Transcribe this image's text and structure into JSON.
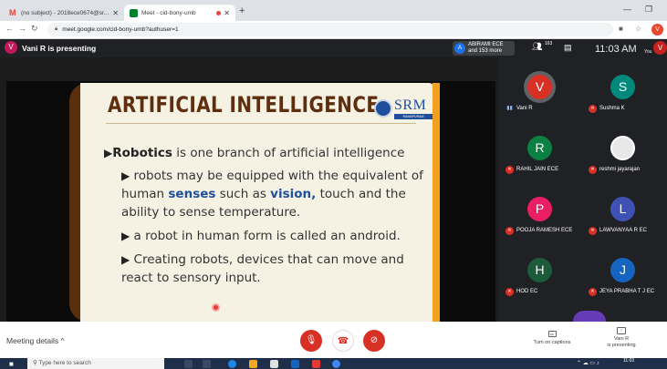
{
  "browser": {
    "tabs": [
      {
        "title": "(no subject) - 2018ece0674@sr...",
        "active": false
      },
      {
        "title": "Meet - cid-bony-umb",
        "active": true
      }
    ],
    "url": "meet.google.com/cid-bony-umb?authuser=1",
    "profile_initial": "V"
  },
  "meet": {
    "presenter_initial": "V",
    "presenter_text": "Vani R is presenting",
    "attendee_initial": "A",
    "attendee_name": "ABIRAMI ECE",
    "attendee_more": "and 153 more",
    "people_count": "163",
    "time": "11:03 AM",
    "you_label": "You",
    "self_initial": "V"
  },
  "slide": {
    "title": "ARTIFICIAL INTELLIGENCE",
    "logo_text": "SRM",
    "logo_sub": "RAMAPURAM",
    "bullet_main_bold": "Robotics",
    "bullet_main_rest": " is one branch of artificial intelligence",
    "sub1_a": "robots may be equipped with the equivalent of human ",
    "sub1_kw1": "senses",
    "sub1_b": " such as ",
    "sub1_kw2": "vision,",
    "sub1_c": " touch and the ability to sense temperature.",
    "sub2": "a robot in human form is called an android.",
    "sub3": "Creating robots, devices that can move and react to sensory input."
  },
  "participants": [
    {
      "name": "Vani R",
      "initial": "V",
      "color": "#d93025",
      "mic_on": true
    },
    {
      "name": "Sushma K",
      "initial": "S",
      "color": "#00897b",
      "mic_on": false
    },
    {
      "name": "RAHIL JAIN ECE",
      "initial": "R",
      "color": "#0b8043",
      "mic_on": false
    },
    {
      "name": "reshmi jayarajan",
      "initial": "",
      "color": "#e8e8e8",
      "mic_on": false
    },
    {
      "name": "POOJA RAMESH ECE",
      "initial": "P",
      "color": "#e91e63",
      "mic_on": false
    },
    {
      "name": "LAWVANYAA R EC",
      "initial": "L",
      "color": "#3f51b5",
      "mic_on": false
    },
    {
      "name": "HOD EC",
      "initial": "H",
      "color": "#1e5b3a",
      "mic_on": false
    },
    {
      "name": "JEYA PRABHA T J EC",
      "initial": "J",
      "color": "#1565c0",
      "mic_on": false
    }
  ],
  "bottom": {
    "meeting_details": "Meeting details",
    "captions_label": "Turn on captions",
    "presenter_label_line1": "Vani R",
    "presenter_label_line2": "is presenting"
  },
  "taskbar": {
    "search_placeholder": "Type here to search",
    "time": "11:03"
  }
}
